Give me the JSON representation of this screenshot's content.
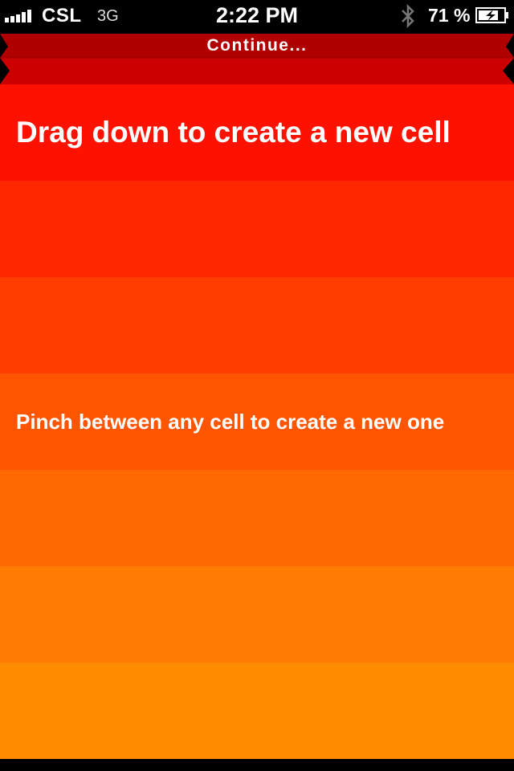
{
  "status_bar": {
    "carrier": "CSL",
    "network": "3G",
    "time": "2:22 PM",
    "battery": "71 %",
    "icons": [
      "signal-bars-icon",
      "bluetooth-icon",
      "battery-charging-icon"
    ]
  },
  "pulldown": {
    "label": "Continue...",
    "color": "#c80000"
  },
  "cells": [
    {
      "text": "Drag down to create a new cell",
      "color": "#ff1100",
      "style": "big"
    },
    {
      "text": "",
      "color": "#ff2600"
    },
    {
      "text": "",
      "color": "#ff3d00"
    },
    {
      "text": "Pinch between any cell to create a new one",
      "color": "#ff5500",
      "style": "small"
    },
    {
      "text": "",
      "color": "#ff6800"
    },
    {
      "text": "",
      "color": "#ff7a00"
    },
    {
      "text": "",
      "color": "#ff8c00"
    }
  ]
}
